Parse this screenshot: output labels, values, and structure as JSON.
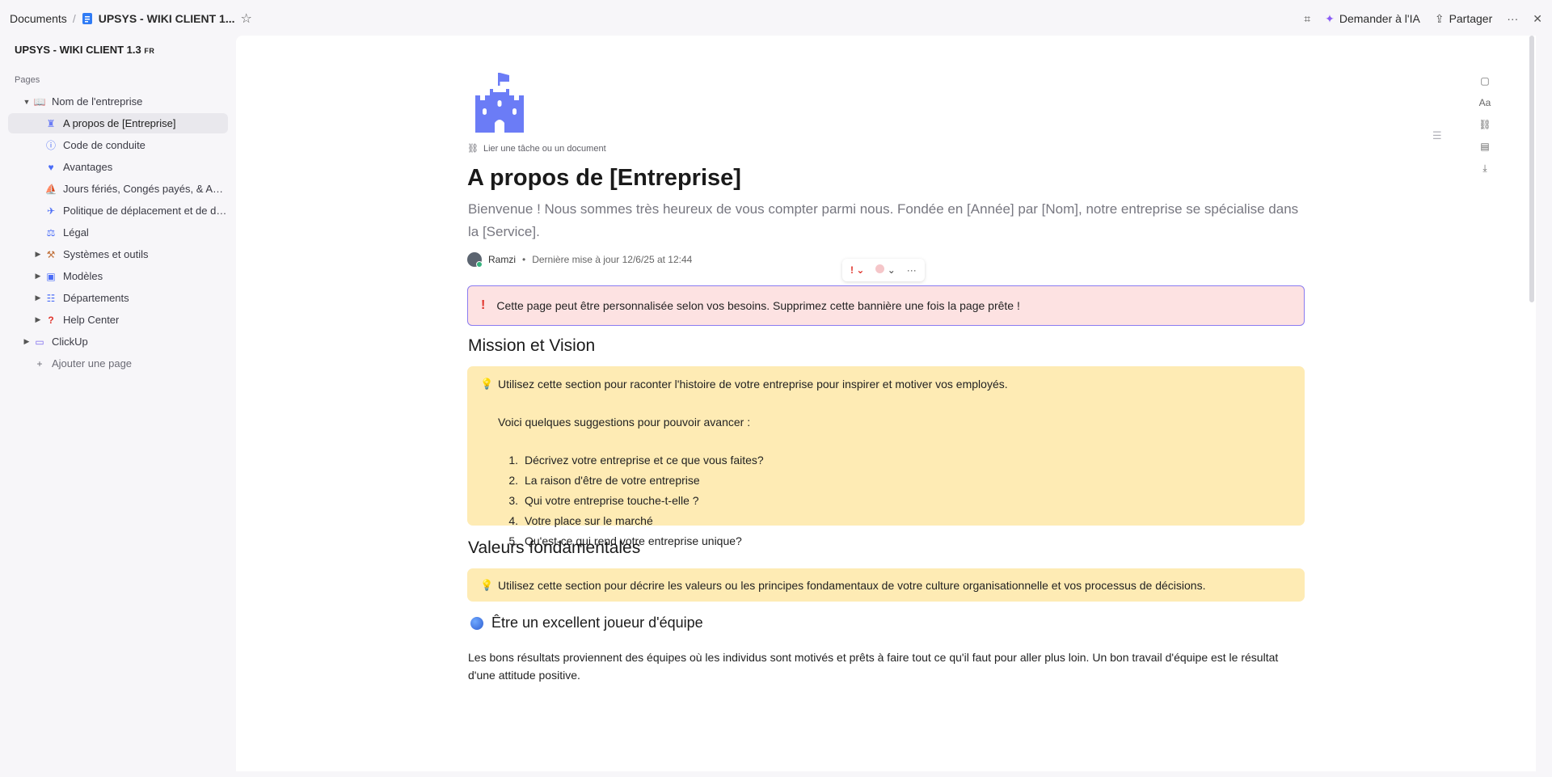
{
  "topbar": {
    "breadcrumb_root": "Documents",
    "breadcrumb_sep": "/",
    "doc_title": "UPSYS - WIKI CLIENT 1...",
    "ask_ai": "Demander à l'IA",
    "share": "Partager",
    "more": "···",
    "close": "✕"
  },
  "sidebar": {
    "workspace_title": "UPSYS - WIKI CLIENT 1.3",
    "workspace_flag": "FR",
    "pages_label": "Pages",
    "items": [
      {
        "label": "Nom de l'entreprise",
        "icon": "book-icon"
      },
      {
        "label": "A propos de [Entreprise]",
        "icon": "castle-icon"
      },
      {
        "label": "Code de conduite",
        "icon": "info-icon"
      },
      {
        "label": "Avantages",
        "icon": "heart-icon"
      },
      {
        "label": "Jours fériés, Congés payés, & Absen...",
        "icon": "swimmer-icon"
      },
      {
        "label": "Politique de déplacement et de dép...",
        "icon": "plane-icon"
      },
      {
        "label": "Légal",
        "icon": "scale-icon"
      },
      {
        "label": "Systèmes et outils",
        "icon": "tools-icon"
      },
      {
        "label": "Modèles",
        "icon": "template-icon"
      },
      {
        "label": "Départements",
        "icon": "people-icon"
      },
      {
        "label": "Help Center",
        "icon": "question-icon"
      },
      {
        "label": "ClickUp",
        "icon": "monitor-icon"
      },
      {
        "label": "Ajouter une page",
        "icon": "plus-icon"
      }
    ]
  },
  "doc": {
    "link_task": "Lier une tâche ou un document",
    "title": "A propos de [Entreprise]",
    "subtitle": "Bienvenue ! Nous sommes très heureux de vous compter parmi nous. Fondée en [Année] par [Nom], notre entreprise se spécialise dans la [Service].",
    "author": "Ramzi",
    "meta_sep": "•",
    "updated": "Dernière mise à jour 12/6/25 at 12:44",
    "banner": "Cette page peut être personnalisée selon vos besoins. Supprimez cette bannière une fois la page prête !",
    "banner_icon": "!",
    "section1_title": "Mission et Vision",
    "callout1_line1": "Utilisez cette section pour raconter l'histoire de votre entreprise pour inspirer et motiver vos employés.",
    "callout1_line2": "Voici quelques suggestions pour pouvoir avancer :",
    "list": [
      "Décrivez votre entreprise et ce que vous faites?",
      "La raison d'être de votre entreprise",
      "Qui votre entreprise touche-t-elle ?",
      "Votre place sur le marché",
      "Qu'est-ce qui rend votre entreprise unique?"
    ],
    "list_nums": [
      "1.",
      "2.",
      "3.",
      "4.",
      "5."
    ],
    "section2_title": "Valeurs fondamentales",
    "callout2": "Utilisez cette section pour décrire les valeurs ou les principes fondamentaux de votre culture organisationnelle et vos processus de décisions.",
    "section3_title": "Être un excellent joueur d'équipe",
    "paragraph": "Les bons résultats proviennent des équipes où les individus sont motivés et prêts à faire tout ce qu'il faut pour aller plus loin. Un bon travail d'équipe est le résultat d'une attitude positive."
  },
  "rail": {
    "font_label": "Aa"
  },
  "colors": {
    "banner_bg": "#fde2e2",
    "banner_border": "#8a7cf0",
    "callout_bg": "#feebb4",
    "castle": "#6b7cf6",
    "accent_red": "#e0332b"
  }
}
